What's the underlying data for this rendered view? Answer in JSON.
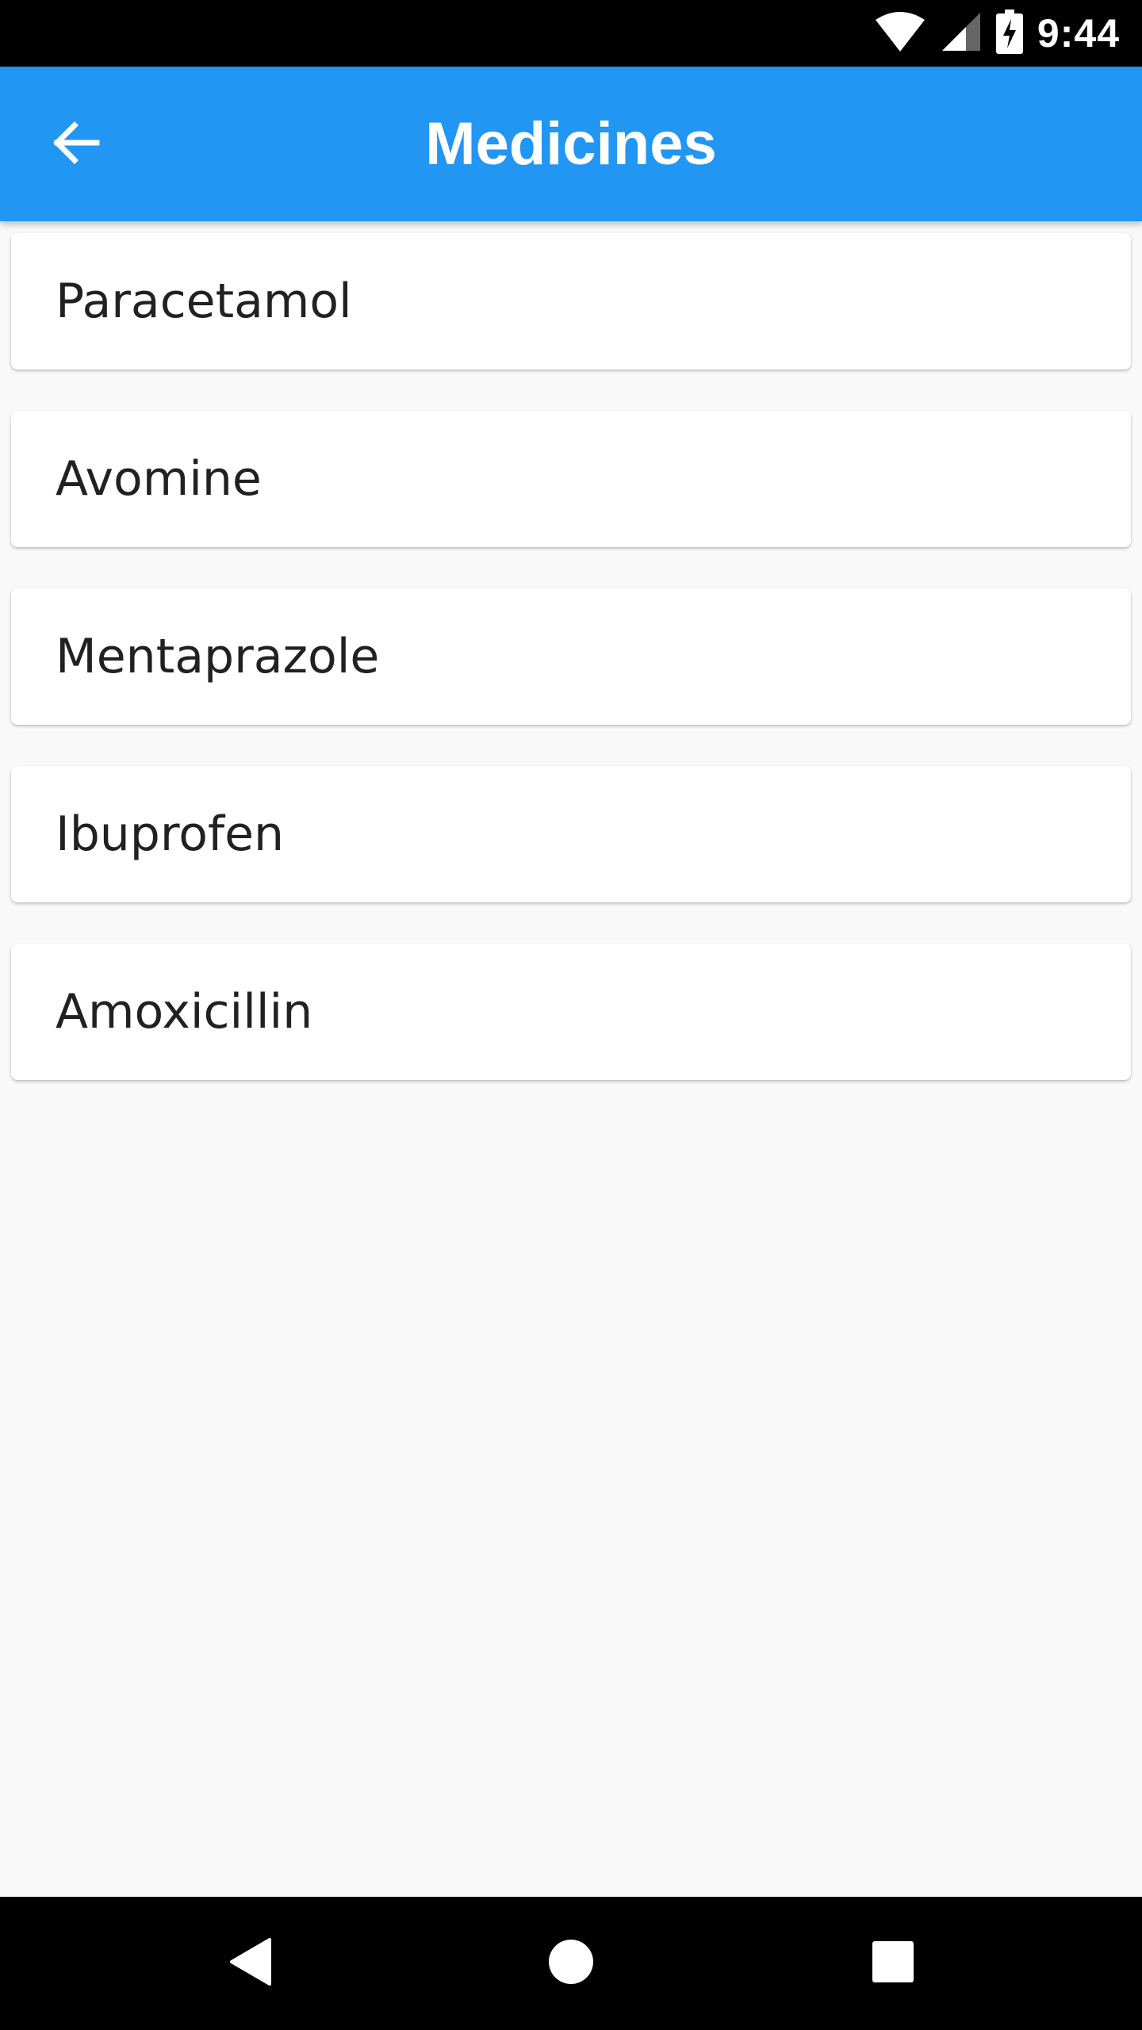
{
  "status_bar": {
    "time": "9:44",
    "icons": [
      "wifi-icon",
      "cell-signal-icon",
      "battery-charging-icon"
    ]
  },
  "app_bar": {
    "title": "Medicines",
    "back_icon": "arrow-back-icon",
    "color": "#2196f3"
  },
  "medicines": [
    {
      "label": "Paracetamol"
    },
    {
      "label": "Avomine"
    },
    {
      "label": "Mentaprazole"
    },
    {
      "label": "Ibuprofen"
    },
    {
      "label": "Amoxicillin"
    }
  ],
  "nav_bar": {
    "buttons": [
      "back-triangle-icon",
      "home-circle-icon",
      "recents-square-icon"
    ]
  }
}
